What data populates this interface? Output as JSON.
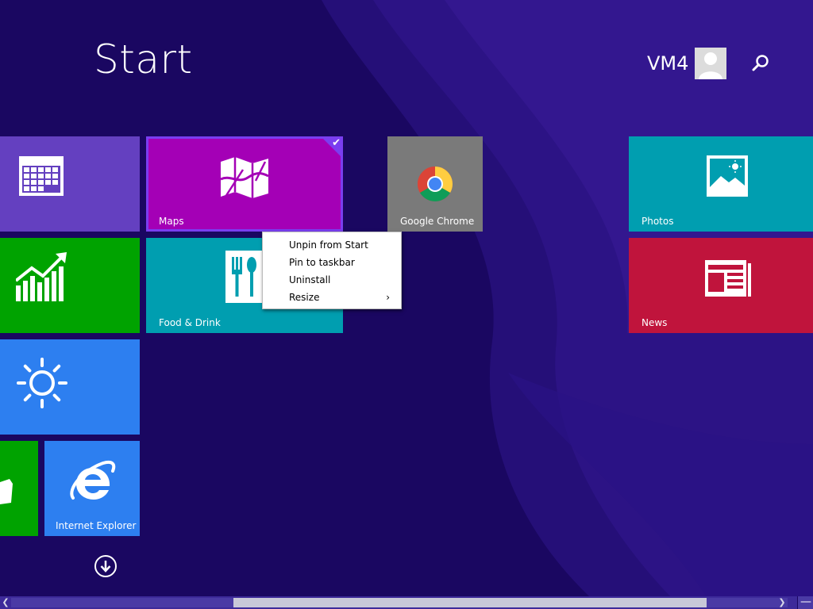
{
  "screen": {
    "title": "Start"
  },
  "user": {
    "name": "VM4"
  },
  "tiles": {
    "maps": {
      "label": "Maps"
    },
    "chrome": {
      "label": "Google Chrome"
    },
    "food": {
      "label": "Food & Drink"
    },
    "photos": {
      "label": "Photos"
    },
    "news": {
      "label": "News"
    },
    "ie": {
      "label": "Internet Explorer"
    }
  },
  "context_menu": {
    "items": [
      {
        "label": "Unpin from Start"
      },
      {
        "label": "Pin to taskbar"
      },
      {
        "label": "Uninstall"
      },
      {
        "label": "Resize",
        "submenu_arrow": "›"
      }
    ]
  },
  "colors": {
    "background": "#1a0761",
    "calendar": "#6440c0",
    "maps": "#a400b6",
    "chrome": "#7a7a7a",
    "finance": "#00a300",
    "food": "#009eb0",
    "weather": "#2d7ff0",
    "store": "#00a300",
    "ie": "#2d7ff0",
    "photos": "#009eb0",
    "news": "#c0143c",
    "selection_accent": "#7a3ef0"
  },
  "icons": {
    "calendar": "calendar-icon",
    "maps": "map-icon",
    "chrome": "chrome-logo-icon",
    "finance": "finance-chart-icon",
    "food": "fork-knife-icon",
    "weather": "sun-icon",
    "store": "store-bag-icon",
    "ie": "internet-explorer-icon",
    "photos": "photo-icon",
    "news": "newspaper-icon",
    "search": "search-icon",
    "user": "user-avatar-icon",
    "apps": "down-arrow-circle-icon"
  }
}
